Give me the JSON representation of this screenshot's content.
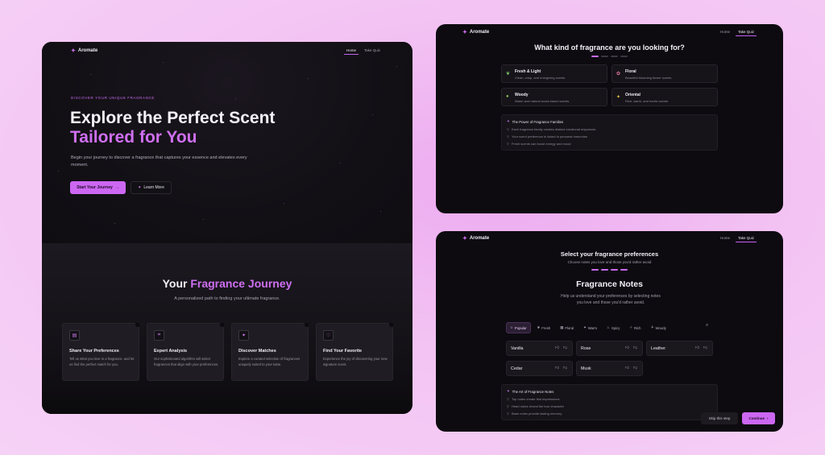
{
  "brand": {
    "name": "Aromate"
  },
  "nav": {
    "home": "Home",
    "quiz": "Take Quiz"
  },
  "landing": {
    "eyebrow": "DISCOVER YOUR UNIQUE FRAGRANCE",
    "headline_1": "Explore the Perfect Scent",
    "headline_2": "Tailored for You",
    "description": "Begin your journey to discover a fragrance that captures your essence and elevates every moment.",
    "primary_cta": "Start Your Journey",
    "secondary_cta": "Learn More",
    "journey_title_a": "Your",
    "journey_title_b": "Fragrance Journey",
    "journey_subtitle": "A personalized path to finding your ultimate fragrance.",
    "steps": [
      {
        "title": "Share Your Preferences",
        "desc": "Tell us what you love in a fragrance, and let us find the perfect match for you.",
        "icon": "clipboard-icon"
      },
      {
        "title": "Expert Analysis",
        "desc": "Our sophisticated algorithm will select fragrances that align with your preferences.",
        "icon": "tag-icon"
      },
      {
        "title": "Discover Matches",
        "desc": "Explore a curated selection of fragrances uniquely suited to your taste.",
        "icon": "sparkle-icon"
      },
      {
        "title": "Find Your Favorite",
        "desc": "Experience the joy of discovering your new signature scent.",
        "icon": "heart-icon"
      }
    ]
  },
  "quiz": {
    "title": "What kind of fragrance are you looking for?",
    "progress_step": 1,
    "progress_total": 4,
    "options": [
      {
        "title": "Fresh & Light",
        "desc": "Clean, crisp, and energizing scents",
        "icon": "leaf-icon"
      },
      {
        "title": "Floral",
        "desc": "Beautiful blooming flower scents",
        "icon": "flower-icon"
      },
      {
        "title": "Woody",
        "desc": "Warm and natural wood-based scents",
        "icon": "tree-icon"
      },
      {
        "title": "Oriental",
        "desc": "Rich, warm, and exotic scents",
        "icon": "sparkle-icon"
      }
    ],
    "info_title": "The Power of Fragrance Families",
    "info_items": [
      "Each fragrance family creates distinct emotional responses",
      "Your scent preference is linked to personal memories",
      "Fresh scents can boost energy and mood"
    ]
  },
  "prefs": {
    "title": "Select your fragrance preferences",
    "subtitle": "Choose notes you love and those you'd rather avoid",
    "progress_step": 4,
    "progress_total": 4,
    "notes_title": "Fragrance Notes",
    "notes_subtitle": "Help us understand your preferences by selecting notes you love and those you'd rather avoid.",
    "filters": [
      "Popular",
      "Fresh",
      "Floral",
      "Warm",
      "Spicy",
      "Rich",
      "Woody"
    ],
    "notes": [
      "Vanilla",
      "Rose",
      "Leather",
      "Cedar",
      "Musk"
    ],
    "info_title": "The Art of Fragrance Notes",
    "info_items": [
      "Top notes create first impressions",
      "Heart notes reveal the true character",
      "Base notes provide lasting memory"
    ],
    "skip": "Skip this step",
    "continue": "Continue"
  },
  "colors": {
    "accent": "#cc67f2",
    "panel": "#0d0b10",
    "background": "#f3c4f3"
  }
}
